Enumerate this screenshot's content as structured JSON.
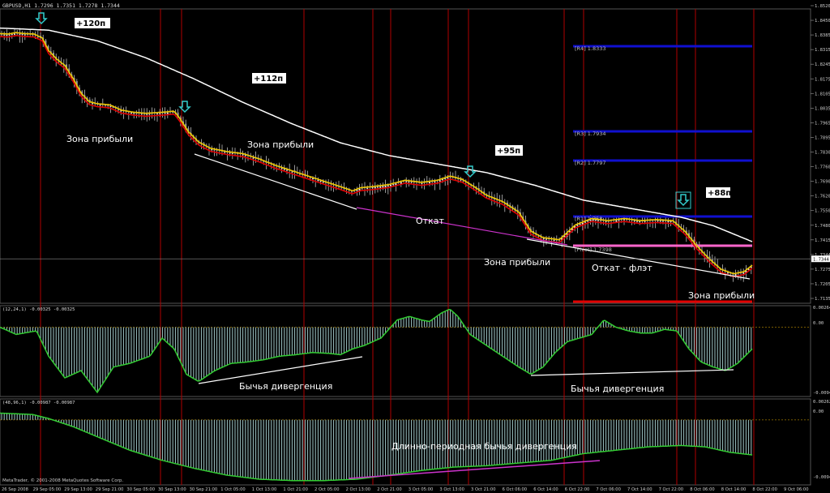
{
  "header": {
    "symbol_line": "GBPUSD,H1  1.7296 1.7351 1.7278 1.7344"
  },
  "colors": {
    "background": "#000000",
    "grid": "#2a2a2a",
    "session_line": "#b00000",
    "bull_candle": "#cfcfcf",
    "price_line": "#f0c800",
    "ma_fast": "#e00000",
    "ma_slow": "#ffffff",
    "pivot_r": "#1010d0",
    "pivot_main": "#ff66cc",
    "trend_support": "#ffffff",
    "divergence_pink": "#cc33cc",
    "macd_line": "#33cc33",
    "histogram": "#a0c8c8",
    "annotation_text": "#ffffff",
    "label_box_bg": "#ffffff",
    "label_box_text": "#000000",
    "arrow_color": "#33cccc"
  },
  "price_axis": {
    "ticks": [
      "1.8520",
      "1.8450",
      "1.8385",
      "1.8315",
      "1.8245",
      "1.8175",
      "1.8105",
      "1.8035",
      "1.7965",
      "1.7895",
      "1.7830",
      "1.7760",
      "1.7690",
      "1.7620",
      "1.7550",
      "1.7480",
      "1.7415",
      "1.7344",
      "1.7275",
      "1.7205",
      "1.7135"
    ],
    "current_price": "1.7344"
  },
  "osc1_axis": {
    "label": "(12,24,1) -0.00325 -0.00325",
    "ticks": [
      "0.00264",
      "0.00",
      "-0.00946"
    ]
  },
  "osc2_axis": {
    "label": "(48,96,1) -0.00987 -0.00987",
    "ticks": [
      "0.00262",
      "0.00",
      "-0.0094"
    ]
  },
  "time_axis": {
    "ticks": [
      "26 Sep 2008",
      "29 Sep 05:00",
      "29 Sep 13:00",
      "29 Sep 21:00",
      "30 Sep 05:00",
      "30 Sep 13:00",
      "30 Sep 21:00",
      "1 Oct 05:00",
      "1 Oct 13:00",
      "1 Oct 21:00",
      "2 Oct 05:00",
      "2 Oct 13:00",
      "2 Oct 21:00",
      "3 Oct 05:00",
      "3 Oct 13:00",
      "3 Oct 21:00",
      "6 Oct 06:00",
      "6 Oct 14:00",
      "6 Oct 22:00",
      "7 Oct 06:00",
      "7 Oct 14:00",
      "7 Oct 22:00",
      "8 Oct 06:00",
      "8 Oct 14:00",
      "8 Oct 22:00",
      "9 Oct 06:00"
    ]
  },
  "pivots": [
    {
      "label": "R4",
      "value": "1.8333"
    },
    {
      "label": "R3",
      "value": "1.7934"
    },
    {
      "label": "R2",
      "value": "1.7797"
    },
    {
      "label": "R1",
      "value": "1.758"
    },
    {
      "label": "Pivot",
      "value": "1.7398"
    }
  ],
  "profit_boxes": [
    "+120п",
    "+112п",
    "+95п",
    "+88п"
  ],
  "annotations": {
    "zone1": "Зона прибыли",
    "zone2": "Зона прибыли",
    "zone3": "Зона прибыли",
    "zone4": "Зона прибыли",
    "pullback": "Откат",
    "pullback_flat": "Откат - флэт",
    "bull_div_1": "Бычья дивергенция",
    "bull_div_2": "Бычья дивергенция",
    "long_div": "Длинно-периодная бычья дивергенция"
  },
  "footer": {
    "copyright": "MetaTrader, © 2001-2008 MetaQuotes Software Corp."
  },
  "chart_data": {
    "type": "line",
    "title": "GBPUSD,H1",
    "ylim": [
      1.7135,
      1.852
    ],
    "price_path": [
      [
        0,
        1.84
      ],
      [
        10,
        1.8398
      ],
      [
        20,
        1.8405
      ],
      [
        30,
        1.84
      ],
      [
        42,
        1.8398
      ],
      [
        52,
        1.838
      ],
      [
        60,
        1.832
      ],
      [
        70,
        1.828
      ],
      [
        80,
        1.825
      ],
      [
        90,
        1.819
      ],
      [
        100,
        1.812
      ],
      [
        110,
        1.808
      ],
      [
        120,
        1.807
      ],
      [
        135,
        1.8065
      ],
      [
        150,
        1.804
      ],
      [
        165,
        1.803
      ],
      [
        180,
        1.8025
      ],
      [
        200,
        1.803
      ],
      [
        215,
        1.8035
      ],
      [
        222,
        1.8
      ],
      [
        232,
        1.794
      ],
      [
        245,
        1.789
      ],
      [
        260,
        1.786
      ],
      [
        280,
        1.7845
      ],
      [
        300,
        1.7835
      ],
      [
        320,
        1.781
      ],
      [
        340,
        1.778
      ],
      [
        360,
        1.7755
      ],
      [
        380,
        1.773
      ],
      [
        400,
        1.7705
      ],
      [
        420,
        1.768
      ],
      [
        435,
        1.766
      ],
      [
        445,
        1.7675
      ],
      [
        460,
        1.768
      ],
      [
        480,
        1.769
      ],
      [
        500,
        1.771
      ],
      [
        520,
        1.77
      ],
      [
        540,
        1.771
      ],
      [
        555,
        1.773
      ],
      [
        570,
        1.7715
      ],
      [
        585,
        1.768
      ],
      [
        600,
        1.764
      ],
      [
        620,
        1.761
      ],
      [
        640,
        1.756
      ],
      [
        655,
        1.747
      ],
      [
        670,
        1.744
      ],
      [
        690,
        1.743
      ],
      [
        710,
        1.75
      ],
      [
        730,
        1.753
      ],
      [
        750,
        1.752
      ],
      [
        770,
        1.753
      ],
      [
        790,
        1.752
      ],
      [
        810,
        1.7525
      ],
      [
        830,
        1.752
      ],
      [
        845,
        1.747
      ],
      [
        860,
        1.74
      ],
      [
        875,
        1.734
      ],
      [
        890,
        1.729
      ],
      [
        905,
        1.727
      ],
      [
        918,
        1.728
      ],
      [
        928,
        1.731
      ]
    ],
    "ma_slow_path": [
      [
        0,
        1.843
      ],
      [
        60,
        1.842
      ],
      [
        120,
        1.837
      ],
      [
        180,
        1.829
      ],
      [
        240,
        1.819
      ],
      [
        300,
        1.808
      ],
      [
        360,
        1.798
      ],
      [
        420,
        1.789
      ],
      [
        480,
        1.783
      ],
      [
        540,
        1.779
      ],
      [
        600,
        1.775
      ],
      [
        660,
        1.769
      ],
      [
        720,
        1.762
      ],
      [
        780,
        1.758
      ],
      [
        840,
        1.754
      ],
      [
        880,
        1.75
      ],
      [
        928,
        1.7425
      ]
    ],
    "osc1": {
      "ylim": [
        -0.00946,
        0.00264
      ],
      "values": [
        [
          0,
          0
        ],
        [
          20,
          -0.001
        ],
        [
          45,
          -0.0005
        ],
        [
          60,
          -0.004
        ],
        [
          80,
          -0.007
        ],
        [
          100,
          -0.006
        ],
        [
          120,
          -0.009
        ],
        [
          140,
          -0.0055
        ],
        [
          160,
          -0.005
        ],
        [
          185,
          -0.004
        ],
        [
          200,
          -0.0015
        ],
        [
          215,
          -0.003
        ],
        [
          230,
          -0.0065
        ],
        [
          245,
          -0.0075
        ],
        [
          265,
          -0.006
        ],
        [
          285,
          -0.005
        ],
        [
          305,
          -0.0048
        ],
        [
          325,
          -0.0045
        ],
        [
          345,
          -0.004
        ],
        [
          365,
          -0.0038
        ],
        [
          385,
          -0.0035
        ],
        [
          405,
          -0.0036
        ],
        [
          420,
          -0.0038
        ],
        [
          435,
          -0.003
        ],
        [
          450,
          -0.0025
        ],
        [
          470,
          -0.0015
        ],
        [
          490,
          0.001
        ],
        [
          505,
          0.0015
        ],
        [
          520,
          0.001
        ],
        [
          530,
          0.0008
        ],
        [
          545,
          0.002
        ],
        [
          555,
          0.0025
        ],
        [
          565,
          0.0015
        ],
        [
          580,
          -0.001
        ],
        [
          600,
          -0.0025
        ],
        [
          620,
          -0.004
        ],
        [
          640,
          -0.0055
        ],
        [
          655,
          -0.0065
        ],
        [
          670,
          -0.0055
        ],
        [
          685,
          -0.0035
        ],
        [
          700,
          -0.002
        ],
        [
          715,
          -0.0015
        ],
        [
          730,
          -0.001
        ],
        [
          745,
          0.001
        ],
        [
          760,
          0.0
        ],
        [
          775,
          -0.0005
        ],
        [
          790,
          -0.0008
        ],
        [
          805,
          -0.0008
        ],
        [
          820,
          -0.0003
        ],
        [
          835,
          -0.0005
        ],
        [
          850,
          -0.003
        ],
        [
          865,
          -0.0048
        ],
        [
          880,
          -0.0055
        ],
        [
          895,
          -0.006
        ],
        [
          910,
          -0.005
        ],
        [
          928,
          -0.003
        ]
      ]
    },
    "osc2": {
      "ylim": [
        -0.0094,
        0.00262
      ],
      "values": [
        [
          0,
          0.001
        ],
        [
          40,
          0.0008
        ],
        [
          60,
          0.0002
        ],
        [
          90,
          -0.001
        ],
        [
          120,
          -0.0025
        ],
        [
          160,
          -0.0045
        ],
        [
          200,
          -0.006
        ],
        [
          240,
          -0.0072
        ],
        [
          280,
          -0.0082
        ],
        [
          320,
          -0.0088
        ],
        [
          360,
          -0.009
        ],
        [
          400,
          -0.009
        ],
        [
          440,
          -0.0088
        ],
        [
          480,
          -0.0082
        ],
        [
          520,
          -0.0075
        ],
        [
          560,
          -0.007
        ],
        [
          600,
          -0.0068
        ],
        [
          640,
          -0.0064
        ],
        [
          680,
          -0.006
        ],
        [
          720,
          -0.005
        ],
        [
          760,
          -0.0045
        ],
        [
          800,
          -0.004
        ],
        [
          840,
          -0.0038
        ],
        [
          870,
          -0.004
        ],
        [
          900,
          -0.0048
        ],
        [
          928,
          -0.0052
        ]
      ]
    }
  }
}
